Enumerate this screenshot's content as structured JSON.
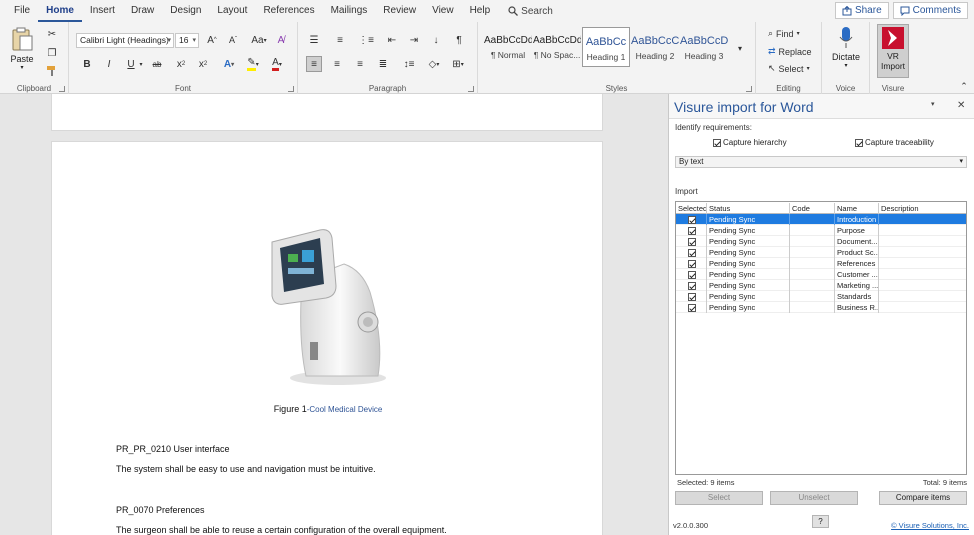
{
  "menu": {
    "tabs": [
      "File",
      "Home",
      "Insert",
      "Draw",
      "Design",
      "Layout",
      "References",
      "Mailings",
      "Review",
      "View",
      "Help"
    ],
    "active_tab": "Home",
    "search_label": "Search",
    "share_label": "Share",
    "comments_label": "Comments"
  },
  "ribbon": {
    "clipboard": {
      "label": "Clipboard",
      "paste_label": "Paste"
    },
    "font": {
      "label": "Font",
      "font_name": "Calibri Light (Headings)",
      "font_size": "16",
      "grow": "A",
      "shrink": "A",
      "case": "Aa",
      "bold": "B",
      "italic": "I",
      "underline": "U",
      "strike": "ab",
      "subscript": "x",
      "superscript": "x"
    },
    "paragraph": {
      "label": "Paragraph"
    },
    "styles": {
      "label": "Styles",
      "items": [
        {
          "sample": "AaBbCcDd",
          "name": "¶ Normal"
        },
        {
          "sample": "AaBbCcDd",
          "name": "¶ No Spac..."
        },
        {
          "sample": "AaBbCc",
          "name": "Heading 1"
        },
        {
          "sample": "AaBbCcC",
          "name": "Heading 2"
        },
        {
          "sample": "AaBbCcDc",
          "name": "Heading 3"
        }
      ]
    },
    "editing": {
      "label": "Editing",
      "find": "Find",
      "replace": "Replace",
      "select": "Select"
    },
    "voice": {
      "label": "Voice",
      "dictate": "Dictate"
    },
    "visure": {
      "label": "Visure",
      "vr_import_line1": "VR",
      "vr_import_line2": "Import"
    }
  },
  "document": {
    "figure_label": "Figure 1",
    "figure_caption": "-Cool Medical Device",
    "req1_title": "PR_PR_0210 User interface",
    "req1_text": "The system shall be easy to use and navigation must be intuitive.",
    "req2_title": "PR_0070 Preferences",
    "req2_text": "The surgeon shall be able to reuse a certain configuration of the overall equipment."
  },
  "pane": {
    "title": "Visure import for Word",
    "identify_label": "Identify requirements:",
    "capture_hierarchy": "Capture hierarchy",
    "capture_traceability": "Capture traceability",
    "identify_mode": "By text",
    "import_label": "Import",
    "columns": [
      "Selected",
      "Status",
      "Code",
      "Name",
      "Description"
    ],
    "rows": [
      {
        "status": "Pending Sync",
        "code": "",
        "name": "Introduction",
        "description": ""
      },
      {
        "status": "Pending Sync",
        "code": "",
        "name": "Purpose",
        "description": ""
      },
      {
        "status": "Pending Sync",
        "code": "",
        "name": "Document...",
        "description": ""
      },
      {
        "status": "Pending Sync",
        "code": "",
        "name": "Product Sc...",
        "description": ""
      },
      {
        "status": "Pending Sync",
        "code": "",
        "name": "References",
        "description": ""
      },
      {
        "status": "Pending Sync",
        "code": "",
        "name": "Customer ...",
        "description": ""
      },
      {
        "status": "Pending Sync",
        "code": "",
        "name": "Marketing ...",
        "description": ""
      },
      {
        "status": "Pending Sync",
        "code": "",
        "name": "Standards",
        "description": ""
      },
      {
        "status": "Pending Sync",
        "code": "",
        "name": "Business R...",
        "description": ""
      }
    ],
    "selected_count": "Selected: 9 items",
    "total_count": "Total: 9 items",
    "select_btn": "Select",
    "unselect_btn": "Unselect",
    "compare_btn": "Compare items",
    "version": "v2.0.0.300",
    "help_btn": "?",
    "copyright": "© Visure Solutions, Inc."
  },
  "colors": {
    "accent": "#2b579a",
    "selection": "#1e7be0",
    "visure_red": "#c8102e"
  }
}
